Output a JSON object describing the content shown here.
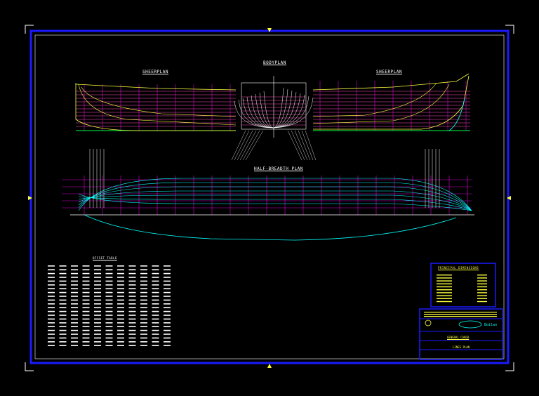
{
  "drawing": {
    "views": {
      "sheer_plan_left": "SHEERPLAN",
      "body_plan": "BODYPLAN",
      "sheer_plan_right": "SHEERPLAN",
      "half_breadth_plan": "HALF-BREADTH PLAN"
    },
    "offset_table": {
      "title": "OFFSET TABLE"
    },
    "particulars": {
      "title": "PRINCIPAL DIMENSIONS"
    },
    "title_block": {
      "project": "GENERAL CARGO",
      "sheet_title": "LINES PLAN",
      "company_mark": "Boilan"
    }
  },
  "colors": {
    "border": "#1a1aff",
    "frame": "#ffffff",
    "grid_magenta": "#ff00ff",
    "hull_yellow": "#ffff40",
    "hull_cyan": "#00ffff",
    "waterline_pink": "#ff4db8",
    "green_axis": "#00ff40",
    "white_lines": "#ffffff",
    "background": "#000000"
  }
}
